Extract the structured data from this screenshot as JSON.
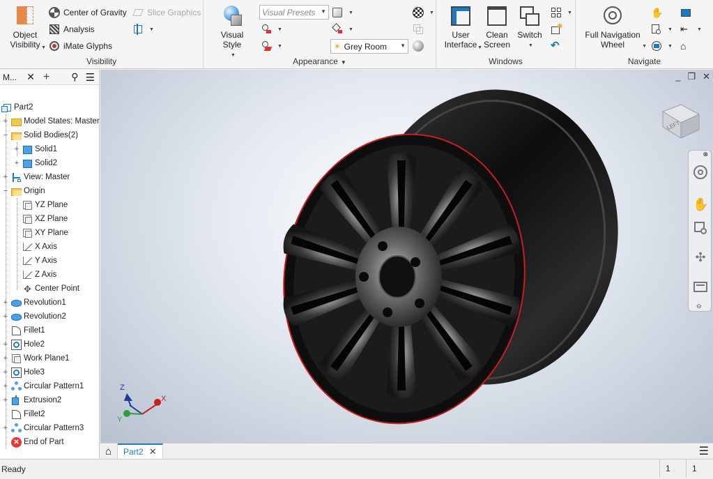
{
  "ribbon": {
    "visibility": {
      "title": "Visibility",
      "object_visibility": "Object\nVisibility",
      "center_of_gravity": "Center of Gravity",
      "analysis": "Analysis",
      "imate_glyphs": "iMate Glyphs",
      "slice_graphics": "Slice Graphics"
    },
    "appearance": {
      "title": "Appearance",
      "visual_style": "Visual Style",
      "visual_presets_placeholder": "Visual Presets",
      "lighting": "Grey Room"
    },
    "windows": {
      "title": "Windows",
      "user_interface": "User\nInterface",
      "clean_screen": "Clean\nScreen",
      "switch": "Switch"
    },
    "navigate": {
      "title": "Navigate",
      "full_navigation_wheel": "Full Navigation\nWheel"
    }
  },
  "browser": {
    "tab_label": "M...",
    "nodes": [
      {
        "label": "Part2"
      },
      {
        "label": "Model States: Master"
      },
      {
        "label": "Solid Bodies(2)"
      },
      {
        "label": "Solid1"
      },
      {
        "label": "Solid2"
      },
      {
        "label": "View: Master"
      },
      {
        "label": "Origin"
      },
      {
        "label": "YZ Plane"
      },
      {
        "label": "XZ Plane"
      },
      {
        "label": "XY Plane"
      },
      {
        "label": "X Axis"
      },
      {
        "label": "Y Axis"
      },
      {
        "label": "Z Axis"
      },
      {
        "label": "Center Point"
      },
      {
        "label": "Revolution1"
      },
      {
        "label": "Revolution2"
      },
      {
        "label": "Fillet1"
      },
      {
        "label": "Hole2"
      },
      {
        "label": "Work Plane1"
      },
      {
        "label": "Hole3"
      },
      {
        "label": "Circular Pattern1"
      },
      {
        "label": "Extrusion2"
      },
      {
        "label": "Fillet2"
      },
      {
        "label": "Circular Pattern3"
      },
      {
        "label": "End of Part"
      }
    ]
  },
  "viewport": {
    "viewcube_face": "LEFT",
    "triad": {
      "x": "X",
      "y": "Y",
      "z": "Z"
    }
  },
  "doc_tabs": {
    "active": "Part2"
  },
  "status": {
    "message": "Ready",
    "count1": "1",
    "count2": "1"
  },
  "colors": {
    "accent": "#1a7bc4",
    "folder": "#f2c94c",
    "solid_body": "#4aa3e8",
    "error": "#e53935"
  }
}
